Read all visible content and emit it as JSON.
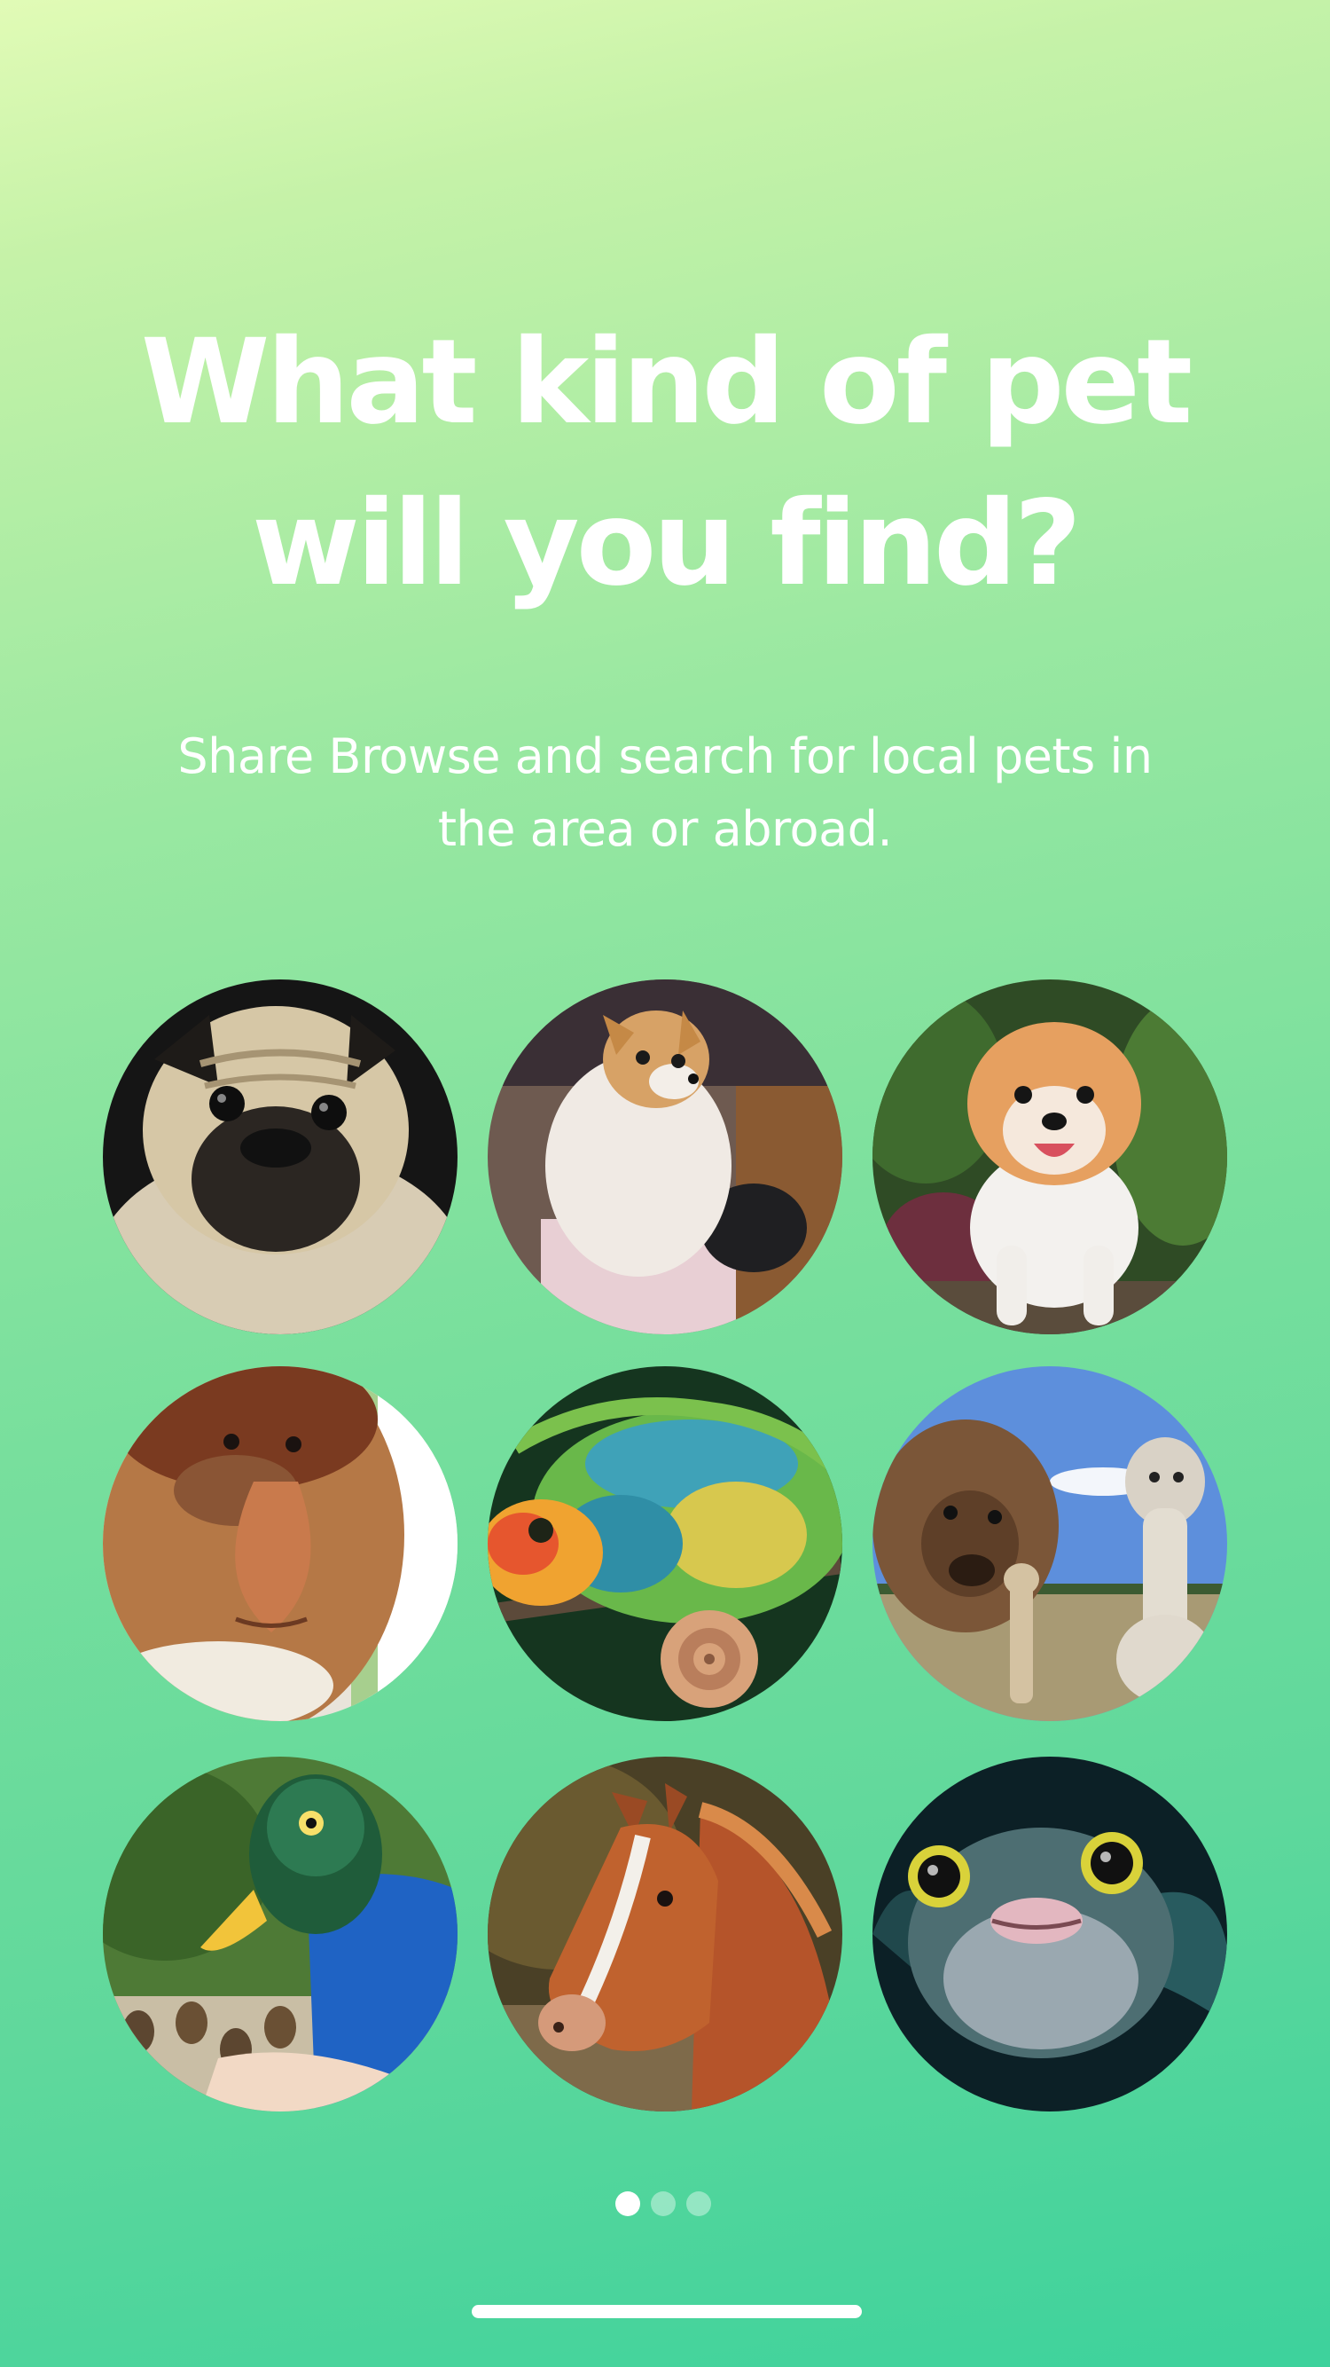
{
  "onboarding": {
    "title_line1": "What kind of pet",
    "title_line2": "will you find?",
    "subtitle_line1": "Share Browse and search for local pets in",
    "subtitle_line2": "the area or abroad."
  },
  "pets": [
    {
      "icon": "pug-photo"
    },
    {
      "icon": "pomeranian-photo"
    },
    {
      "icon": "fluffy-puppy-photo"
    },
    {
      "icon": "proboscis-monkey-photo"
    },
    {
      "icon": "chameleon-photo"
    },
    {
      "icon": "alpaca-photo"
    },
    {
      "icon": "duck-mask-person-photo"
    },
    {
      "icon": "horse-photo"
    },
    {
      "icon": "pufferfish-photo"
    }
  ],
  "pager": {
    "page_count": 3,
    "active_index": 0
  },
  "colors": {
    "gradient_top": "#e1fbb6",
    "gradient_bottom": "#3dd29c",
    "text": "#ffffff"
  }
}
